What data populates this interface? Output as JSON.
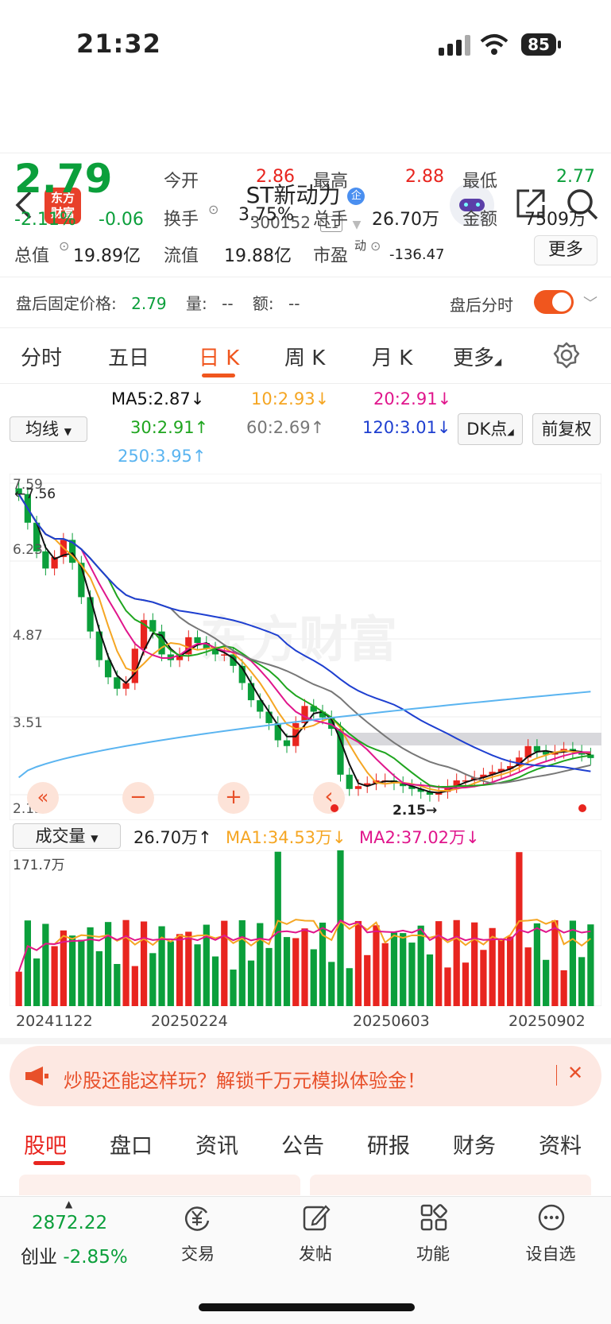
{
  "status_bar": {
    "time": "21:32",
    "battery": "85"
  },
  "header": {
    "title": "ST新动力",
    "code": "300152",
    "level": "L1",
    "logo": "东方\n财富",
    "corp_badge": "企"
  },
  "quote": {
    "price": "2.79",
    "change_pct": "-2.11%",
    "change": "-0.06",
    "open_label": "今开",
    "open": "2.86",
    "high_label": "最高",
    "high": "2.88",
    "low_label": "最低",
    "low": "2.77",
    "turnover_label": "换手",
    "turnover": "3.75%",
    "volume_label": "总手",
    "volume": "26.70万",
    "amount_label": "金额",
    "amount": "7509万",
    "mktcap_label": "总值",
    "mktcap": "19.89亿",
    "float_label": "流值",
    "float": "19.88亿",
    "pe_label": "市盈",
    "pe_sup": "动",
    "pe": "-136.47",
    "more_button": "更多"
  },
  "after_hours": {
    "label": "盘后固定价格:",
    "price": "2.79",
    "vol_label": "量:",
    "vol": "--",
    "amt_label": "额:",
    "amt": "--",
    "intraday_label": "盘后分时"
  },
  "tabs": [
    "分时",
    "五日",
    "日 K",
    "周 K",
    "月 K",
    "更多"
  ],
  "active_tab": "日 K",
  "indicators": {
    "ma_select": "均线",
    "ma5": "MA5:2.87",
    "ma10": "10:2.93",
    "ma20": "20:2.91",
    "ma30": "30:2.91",
    "ma60": "60:2.69",
    "ma120": "120:3.01",
    "ma250": "250:3.95",
    "dk_button": "DK点",
    "fq_button": "前复权",
    "colors": {
      "ma5": "#111111",
      "ma10": "#f5a623",
      "ma20": "#e0168c",
      "ma30": "#1fa51f",
      "ma60": "#777777",
      "ma120": "#1e3fd0",
      "ma250": "#5ab4f0"
    }
  },
  "chart_data": {
    "type": "line",
    "price_axis": [
      "7.59",
      "6.23",
      "4.87",
      "3.51",
      "2.15"
    ],
    "annotations": [
      "7.56",
      "2.15"
    ],
    "close": [
      7.4,
      6.9,
      6.4,
      6.1,
      6.3,
      6.6,
      6.2,
      5.6,
      5.0,
      4.5,
      4.2,
      4.0,
      4.1,
      4.7,
      5.2,
      5.0,
      4.6,
      4.5,
      4.6,
      4.9,
      4.8,
      4.7,
      4.6,
      4.6,
      4.4,
      4.1,
      3.8,
      3.6,
      3.4,
      3.1,
      3.0,
      3.4,
      3.7,
      3.6,
      3.5,
      3.3,
      2.5,
      2.25,
      2.3,
      2.35,
      2.4,
      2.4,
      2.35,
      2.3,
      2.25,
      2.2,
      2.15,
      2.2,
      2.3,
      2.4,
      2.4,
      2.45,
      2.5,
      2.55,
      2.6,
      2.65,
      2.8,
      3.0,
      2.9,
      2.85,
      2.9,
      2.95,
      2.9,
      2.85,
      2.79
    ],
    "x_dates": [
      "20241122",
      "20250224",
      "20250603",
      "20250902"
    ],
    "volume": {
      "select": "成交量",
      "value": "26.70万",
      "ma1": "MA1:34.53万",
      "ma2": "MA2:37.02万",
      "axis_max": "171.7万"
    }
  },
  "chart_controls": [
    "«",
    "−",
    "+",
    "‹"
  ],
  "banner": {
    "text": "炒股还能这样玩？解锁千万元模拟体验金！"
  },
  "bottom_tabs": [
    "股吧",
    "盘口",
    "资讯",
    "公告",
    "研报",
    "财务",
    "资料"
  ],
  "navbar": {
    "index_value": "2872.22",
    "index_label": "创业",
    "index_change": "-2.85%",
    "items": [
      "交易",
      "发帖",
      "功能",
      "设自选"
    ]
  }
}
